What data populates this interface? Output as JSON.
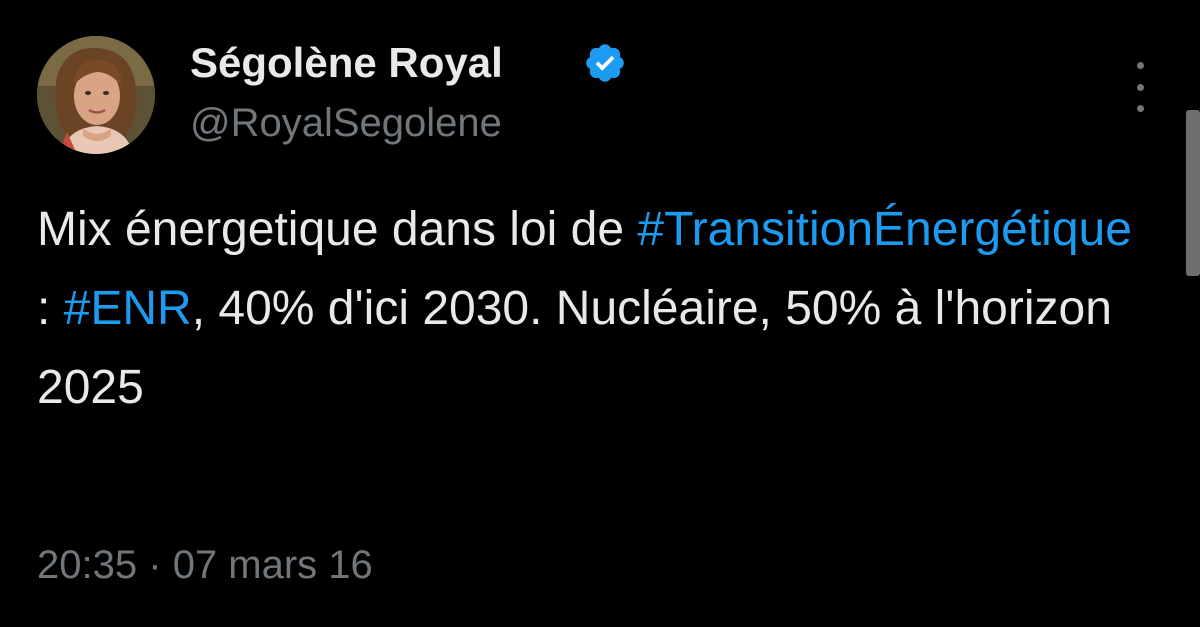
{
  "author": {
    "display_name": "Ségolène Royal",
    "handle": "@RoyalSegolene",
    "verified": true,
    "avatar_icon": "profile-photo"
  },
  "tweet": {
    "segments": [
      {
        "text": "Mix énergetique dans loi de ",
        "type": "text"
      },
      {
        "text": "#TransitionÉnergétique",
        "type": "hashtag"
      },
      {
        "text": " : ",
        "type": "text"
      },
      {
        "text": "#ENR",
        "type": "hashtag"
      },
      {
        "text": ", 40% d'ici 2030. Nucléaire, 50% à l'horizon 2025",
        "type": "text"
      }
    ],
    "time": "20:35",
    "separator": "·",
    "date": "07 mars 16"
  },
  "menu": {
    "icon": "more-options-icon"
  },
  "colors": {
    "background": "#000000",
    "text": "#e7e9ea",
    "secondary": "#71767b",
    "accent": "#1d9bf0"
  }
}
